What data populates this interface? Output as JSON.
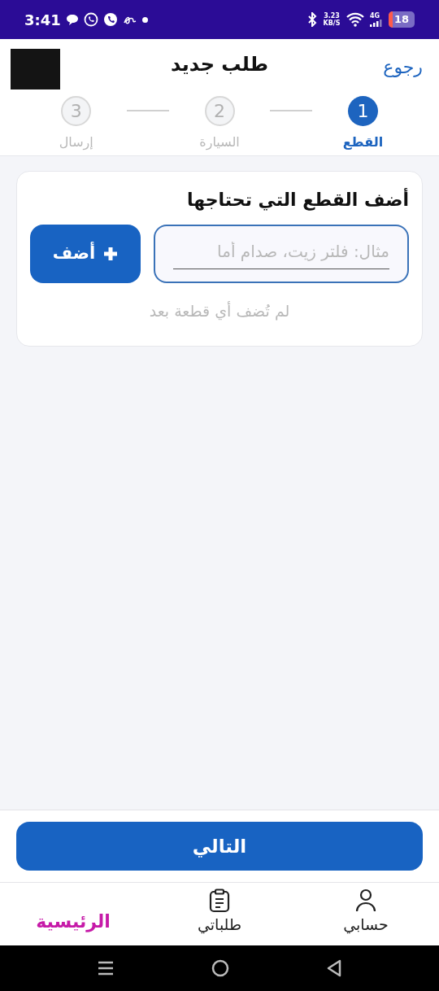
{
  "status_bar": {
    "time": "3:41",
    "speed": "3.23 KB/S",
    "network": "4G",
    "battery": "18"
  },
  "header": {
    "title": "طلب جديد",
    "back": "رجوع"
  },
  "steps": [
    {
      "number": "1",
      "label": "القطع",
      "selected": true
    },
    {
      "number": "2",
      "label": "السيارة",
      "selected": false
    },
    {
      "number": "3",
      "label": "إرسال",
      "selected": false
    }
  ],
  "card": {
    "title": "أضف القطع التي تحتاجها",
    "input": {
      "placeholder": "مثال: فلتر زيت، صدام أما"
    },
    "add_button": "أضف",
    "empty_text": "لم تُضف أي قطعة بعد"
  },
  "next_button": "التالي",
  "bottom_nav": [
    {
      "label": "حسابي",
      "kind": "account",
      "selected": false
    },
    {
      "label": "طلباتي",
      "kind": "orders",
      "selected": false
    },
    {
      "label": "الرئيسية",
      "selected": true
    }
  ]
}
